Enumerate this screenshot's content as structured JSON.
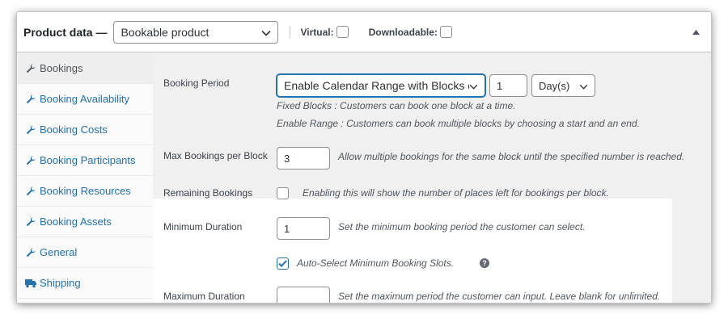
{
  "header": {
    "title": "Product data —",
    "product_type": "Bookable product",
    "virtual_label": "Virtual:",
    "downloadable_label": "Downloadable:"
  },
  "sidebar": {
    "items": [
      {
        "label": "Bookings",
        "icon": "wrench-icon",
        "active": true
      },
      {
        "label": "Booking Availability",
        "icon": "wrench-icon"
      },
      {
        "label": "Booking Costs",
        "icon": "wrench-icon"
      },
      {
        "label": "Booking Participants",
        "icon": "wrench-icon"
      },
      {
        "label": "Booking Resources",
        "icon": "wrench-icon"
      },
      {
        "label": "Booking Assets",
        "icon": "wrench-icon"
      },
      {
        "label": "General",
        "icon": "wrench-icon"
      },
      {
        "label": "Shipping",
        "icon": "truck-icon"
      }
    ]
  },
  "fields": {
    "booking_period": {
      "label": "Booking Period",
      "mode": "Enable Calendar Range with Blocks of",
      "amount": "1",
      "unit": "Day(s)",
      "desc_fixed": "Fixed Blocks : Customers can book one block at a time.",
      "desc_range": "Enable Range : Customers can book multiple blocks by choosing a start and an end."
    },
    "max_bookings": {
      "label": "Max Bookings per Block",
      "value": "3",
      "desc": "Allow multiple bookings for the same block until the specified number is reached."
    },
    "remaining": {
      "label": "Remaining Bookings",
      "desc": "Enabling this will show the number of places left for bookings per block."
    },
    "min_duration": {
      "label": "Minimum Duration",
      "value": "1",
      "desc": "Set the minimum booking period the customer can select."
    },
    "auto_select": {
      "label": "Auto-Select Minimum Booking Slots.",
      "checked": true
    },
    "max_duration": {
      "label": "Maximum Duration",
      "value": "",
      "desc": "Set the maximum period the customer can input. Leave blank for unlimited."
    }
  },
  "colors": {
    "link": "#2271b1",
    "panel_bg": "#f0f0f1",
    "border": "#c3c4c7"
  }
}
